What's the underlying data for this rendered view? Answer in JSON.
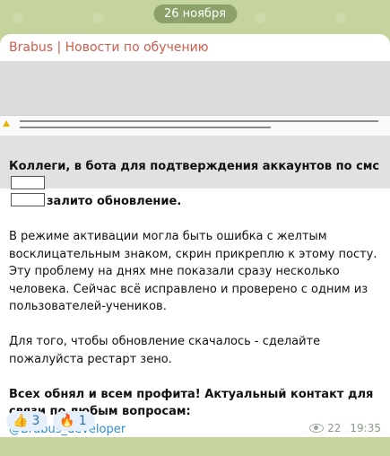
{
  "date_label": "26 ноября",
  "post": {
    "channel": "Brabus | Новости по обучению",
    "headline_start": "Коллеги, в бота для подтверждения аккаунтов по смс",
    "headline_end": "залито обновление.",
    "paragraph_2": "В режиме активации могла быть ошибка с желтым восклицательным знаком, скрин прикреплю к этому посту. Эту проблему на днях мне показали сразу несколько человека. Сейчас всё исправлено и проверено с одним из пользователей-учеников.",
    "paragraph_3": "Для того, чтобы обновление скачалось - сделайте пожалуйста рестарт зено.",
    "closing": "Всех обнял и всем профита! Актуальный контакт для связи по любым вопросам:",
    "contact_link": "@Brabus_developer",
    "reactions": [
      {
        "emoji": "👍",
        "count": "3"
      },
      {
        "emoji": "🔥",
        "count": "1"
      }
    ],
    "views": "22",
    "time": "19:35"
  }
}
